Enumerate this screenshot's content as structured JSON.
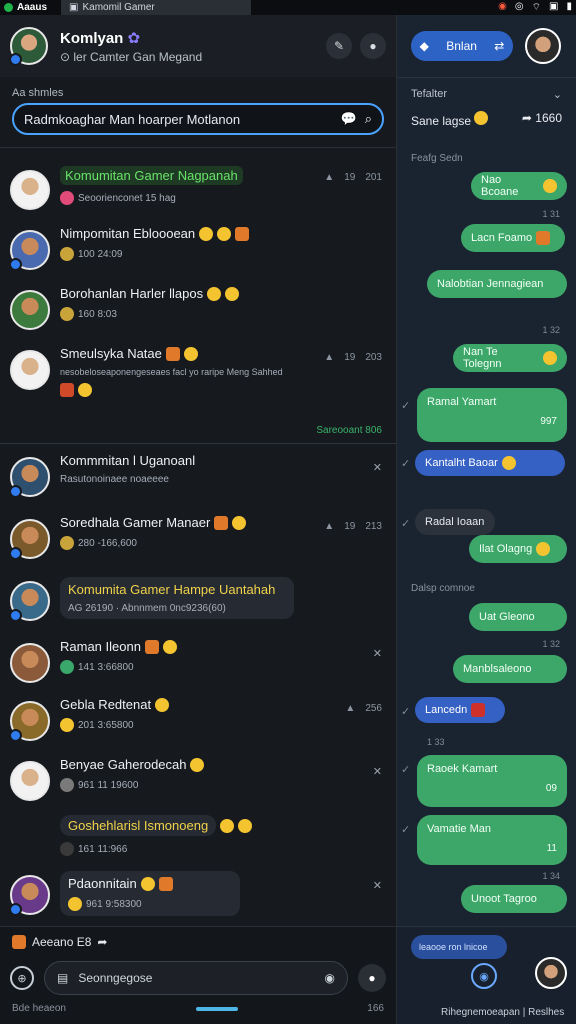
{
  "statusbar": {
    "app": "Aaaus",
    "tab": "Kamomil Gamer",
    "icons": [
      "shield-icon",
      "location-icon",
      "wifi-icon",
      "screen-icon",
      "battery-icon"
    ]
  },
  "topbar": {
    "title": "Komlyan",
    "subtitle": "ler Camter Gan Megand"
  },
  "section_label": "Aa shmles",
  "search": {
    "value": "Radmkoaghar Man hoarper Motlanon"
  },
  "chats": [
    {
      "name": "Komumitan Gamer Nagpanah",
      "sub": "Seoorienconet 15 hag",
      "meta1": "19",
      "meta2": "201",
      "avatar": "#3b6a4a",
      "style": "hl"
    },
    {
      "name": "Nimpomitan Ebloooean",
      "sub": "100 24:09",
      "avatar": "#4a6ab0",
      "style": ""
    },
    {
      "name": "Borohanlan Harler llapos",
      "sub": "160 8:03",
      "avatar": "#3d7a3d",
      "style": ""
    },
    {
      "name": "Smeulsyka Natae",
      "sub": "nesobeloseaponengeseaes facl yo raripe Meng Sahhed",
      "meta1": "19",
      "meta2": "203",
      "avatar": "#6b5a4a",
      "style": ""
    }
  ],
  "pinned": "Sareooant 806",
  "chats2": [
    {
      "name": "Kommmitan l Uganoanl",
      "sub": "Rasutonoinaee noaeeee",
      "avatar": "#2e4f6e",
      "style": ""
    },
    {
      "name": "Soredhala Gamer Manaer",
      "sub": "280 -166,600",
      "meta1": "19",
      "meta2": "213",
      "avatar": "#7a5a2a",
      "style": ""
    },
    {
      "name": "Komumita Gamer Hampe Uantahah",
      "sub": "AG 26190 · Abnnmem 0nc9236(60)",
      "avatar": "#3a6a8a",
      "style": "yl"
    },
    {
      "name": "Raman Ileonn",
      "sub": "141 3:66800",
      "avatar": "#8a5a3a",
      "style": ""
    },
    {
      "name": "Gebla Redtenat",
      "sub": "201 3:65800",
      "meta1": "",
      "meta2": "256",
      "avatar": "#8a6a2a",
      "style": ""
    },
    {
      "name": "Benyae Gaherodecah",
      "sub": "961 11 19600",
      "avatar": "#3a5a7a",
      "style": ""
    },
    {
      "name": "Goshehlarisl Ismonoeng",
      "sub": "161 11:966",
      "avatar": "",
      "style": "yl"
    },
    {
      "name": "Pdaonnitain",
      "sub": "961 9:58300",
      "avatar": "#6a3a8a",
      "style": ""
    }
  ],
  "compose": {
    "top": "Aeeano E8",
    "placeholder": "Seonngegose",
    "left_foot": "Bde heaeon",
    "right_foot": "166"
  },
  "right": {
    "pill_label": "Bnlan",
    "header": "Tefalter",
    "subheader": "Sane lagse",
    "subheader_right": "1660",
    "label1": "Feafg Sedn",
    "label2": "Dalsp comnoe",
    "messages": [
      "Nao Bcoane",
      "Lacn Foamo",
      "Nalobtian Jennagiean",
      "Nan Te Tolegnn",
      "Ramal Yamart",
      "Kantalht Baoar",
      "Radal Ioaan",
      "Ilat Olagng",
      "Uat Gleono",
      "Manblsaleono",
      "Lancedn",
      "Raoek Kamart",
      "Vamatie Man",
      "Unoot Tagroo"
    ],
    "times": [
      "1 31",
      "1 32",
      "1 32",
      "1 33",
      "1 34",
      "1 35"
    ],
    "msg_meta": [
      "997",
      "09",
      "11"
    ],
    "bottom_pill": "leaooe ron lnicoe",
    "bottom_text": "Rihegnemoeapan | Reslhes"
  }
}
